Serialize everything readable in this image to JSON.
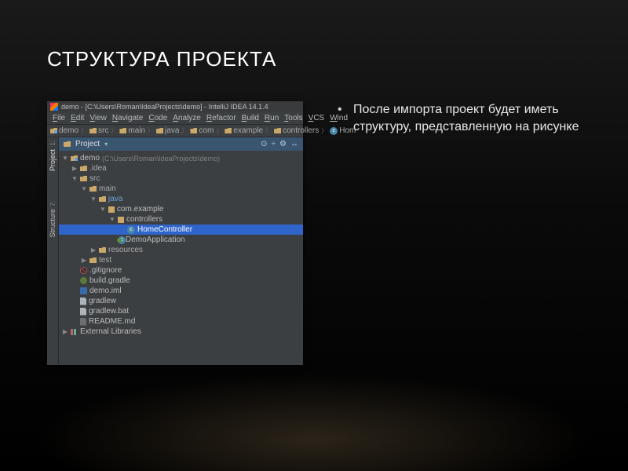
{
  "slide": {
    "title": "СТРУКТУРА ПРОЕКТА",
    "bullet": "После импорта проект будет иметь структуру, представленную на рисунке"
  },
  "ide": {
    "title": "demo - [C:\\Users\\Roman\\IdeaProjects\\demo] - IntelliJ IDEA 14.1.4",
    "menu": [
      "File",
      "Edit",
      "View",
      "Navigate",
      "Code",
      "Analyze",
      "Refactor",
      "Build",
      "Run",
      "Tools",
      "VCS",
      "Wind"
    ],
    "crumbs": [
      "demo",
      "src",
      "main",
      "java",
      "com",
      "example",
      "controllers",
      "Hom"
    ],
    "leftTabs": {
      "project": "Project",
      "project_num": "1:",
      "structure": "Structure",
      "structure_num": "7:"
    },
    "panel": {
      "title": "Project",
      "tools": [
        "⊙",
        "÷",
        "⚙",
        "↔"
      ]
    },
    "tree": [
      {
        "depth": 0,
        "tw": "exp",
        "icon": "module",
        "text": "demo",
        "suffix": " (C:\\Users\\Roman\\IdeaProjects\\demo)"
      },
      {
        "depth": 1,
        "tw": "col",
        "icon": "folder",
        "text": ".idea",
        "muted": true
      },
      {
        "depth": 1,
        "tw": "exp",
        "icon": "folder",
        "text": "src",
        "muted": true
      },
      {
        "depth": 2,
        "tw": "exp",
        "icon": "folder",
        "text": "main",
        "muted": true
      },
      {
        "depth": 3,
        "tw": "exp",
        "icon": "folder",
        "text": "java",
        "blue": true
      },
      {
        "depth": 4,
        "tw": "exp",
        "icon": "pkg",
        "text": "com.example"
      },
      {
        "depth": 5,
        "tw": "exp",
        "icon": "pkg",
        "text": "controllers"
      },
      {
        "depth": 6,
        "tw": "",
        "icon": "class",
        "text": "HomeController",
        "selected": true,
        "green": true
      },
      {
        "depth": 5,
        "tw": "",
        "icon": "class",
        "text": "DemoApplication",
        "green": true
      },
      {
        "depth": 3,
        "tw": "col",
        "icon": "folder",
        "text": "resources",
        "muted": true
      },
      {
        "depth": 2,
        "tw": "col",
        "icon": "folder",
        "text": "test",
        "muted": true
      },
      {
        "depth": 1,
        "tw": "",
        "icon": "gitignore",
        "text": ".gitignore"
      },
      {
        "depth": 1,
        "tw": "",
        "icon": "gradle",
        "text": "build.gradle"
      },
      {
        "depth": 1,
        "tw": "",
        "icon": "iml",
        "text": "demo.iml"
      },
      {
        "depth": 1,
        "tw": "",
        "icon": "file",
        "text": "gradlew"
      },
      {
        "depth": 1,
        "tw": "",
        "icon": "file",
        "text": "gradlew.bat"
      },
      {
        "depth": 1,
        "tw": "",
        "icon": "md",
        "text": "README.md"
      },
      {
        "depth": 0,
        "tw": "col",
        "icon": "lib",
        "text": "External Libraries"
      }
    ]
  }
}
